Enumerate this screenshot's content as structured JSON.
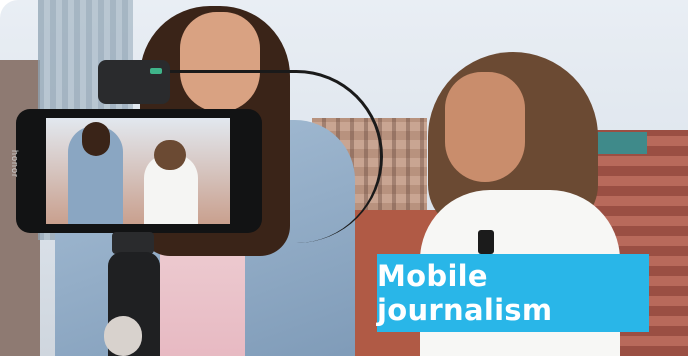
{
  "phone": {
    "brand_label": "honor"
  },
  "caption": {
    "text": "Mobile journalism",
    "background_color": "#29b6e8",
    "text_color": "#ffffff"
  }
}
